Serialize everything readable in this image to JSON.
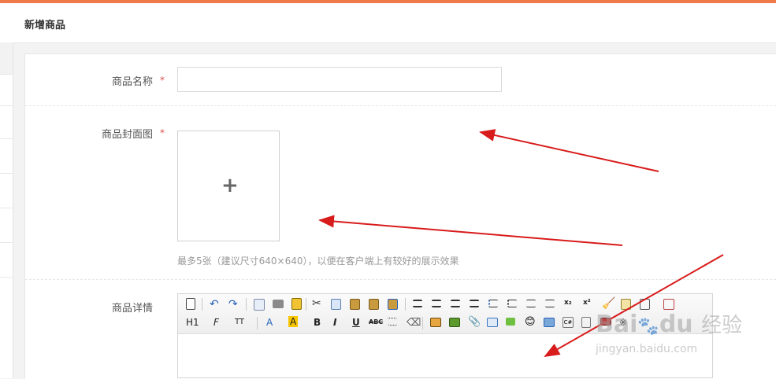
{
  "header": {
    "title": "新增商品"
  },
  "form": {
    "name_label": "商品名称",
    "cover_label": "商品封面图",
    "detail_label": "商品详情",
    "required_mark": "*",
    "name_value": "",
    "upload_plus": "+",
    "upload_hint": "最多5张（建议尺寸640×640），以便在客户端上有较好的展示效果"
  },
  "editor": {
    "heading_btn": "H1",
    "font_family_btn": "F",
    "font_size_btn": "TT",
    "font_color_btn": "A",
    "highlight_btn": "A",
    "bold_btn": "B",
    "italic_btn": "I",
    "underline_btn": "U",
    "strike_btn": "ABC",
    "superscript_btn": "x²",
    "subscript_btn": "x₂"
  },
  "watermark": {
    "brand_a": "Bai",
    "brand_b": "du",
    "brand_cn": "经验",
    "url": "jingyan.baidu.com"
  },
  "colors": {
    "accent": "#f07a4a",
    "arrow": "#d81b1b",
    "required": "#d9534f"
  }
}
